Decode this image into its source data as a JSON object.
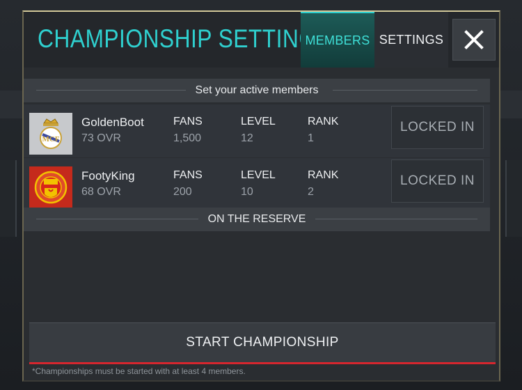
{
  "header": {
    "title": "CHAMPIONSHIP SETTINGS",
    "tabs": [
      {
        "label": "MEMBERS",
        "active": true
      },
      {
        "label": "SETTINGS",
        "active": false
      }
    ],
    "close_icon": "close-icon"
  },
  "sections": {
    "active_title": "Set your active members",
    "reserve_title": "ON THE RESERVE"
  },
  "columns": {
    "fans": "FANS",
    "level": "LEVEL",
    "rank": "RANK"
  },
  "members": [
    {
      "name": "GoldenBoot",
      "ovr": "73 OVR",
      "fans": "1,500",
      "level": "12",
      "rank": "1",
      "status": "LOCKED IN",
      "crest": "real-madrid-crest-icon"
    },
    {
      "name": "FootyKing",
      "ovr": "68 OVR",
      "fans": "200",
      "level": "10",
      "rank": "2",
      "status": "LOCKED IN",
      "crest": "manchester-united-crest-icon"
    }
  ],
  "footer": {
    "start_label": "START CHAMPIONSHIP",
    "note": "*Championships must be started with at least 4 members."
  },
  "colors": {
    "accent": "#2fd0cf",
    "start_underline": "#d6262e"
  }
}
